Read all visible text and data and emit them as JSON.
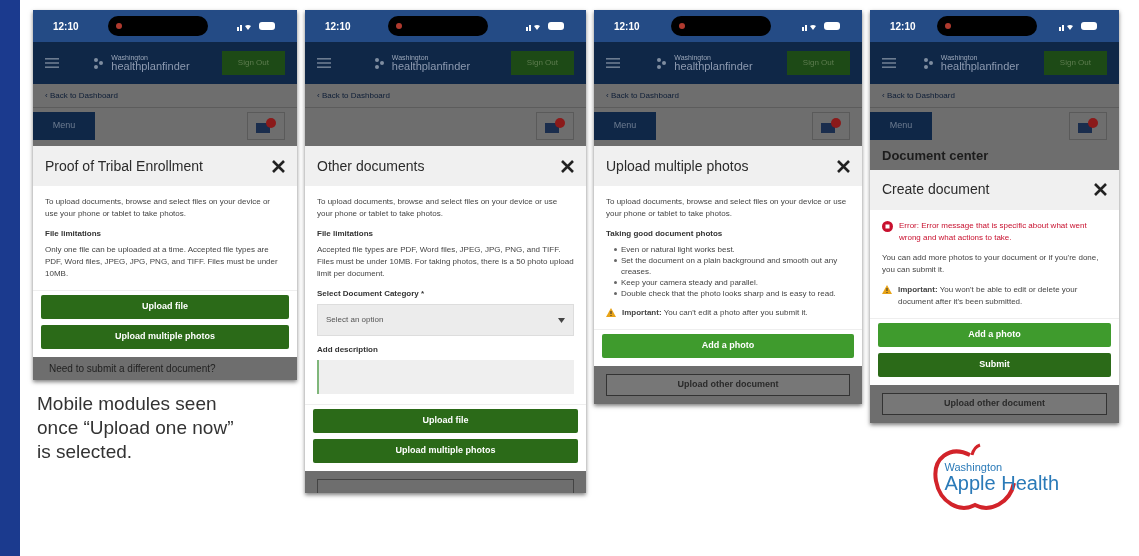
{
  "phones": [
    {
      "time": "12:10",
      "brand_top": "Washington",
      "brand": "healthplanfinder",
      "sign_out": "Sign Out",
      "back_link": "‹ Back to Dashboard",
      "menu": "Menu",
      "modal": {
        "title": "Proof of Tribal Enrollment",
        "blocks": [
          {
            "kind": "paragraph",
            "text": "To upload documents, browse and select files on your device or use your phone or tablet to take photos."
          },
          {
            "kind": "heading",
            "text": "File limitations"
          },
          {
            "kind": "paragraph",
            "text": "Only one file can be uploaded at a time. Accepted file types are PDF, Word files, JPEG, JPG, PNG, and TIFF. Files must be under 10MB."
          }
        ],
        "buttons": [
          {
            "label": "Upload file",
            "kind": "secondary"
          },
          {
            "label": "Upload multiple photos",
            "kind": "secondary"
          }
        ]
      },
      "below": {
        "kind": "text",
        "text": "Need to submit a different document?"
      }
    },
    {
      "time": "12:10",
      "brand_top": "Washington",
      "brand": "healthplanfinder",
      "sign_out": "Sign Out",
      "back_link": "‹ Back to Dashboard",
      "modal": {
        "title": "Other documents",
        "blocks": [
          {
            "kind": "paragraph",
            "text": "To upload documents, browse and select files on your device or use your phone or tablet to take photos."
          },
          {
            "kind": "heading",
            "text": "File limitations"
          },
          {
            "kind": "paragraph",
            "text": "Accepted file types are PDF, Word files, JPEG, JPG, PNG, and TIFF. Files must be under 10MB. For taking photos, there is a 50 photo upload limit per document."
          },
          {
            "kind": "select",
            "label": "Select Document Category *",
            "placeholder": "Select an option"
          },
          {
            "kind": "textarea",
            "label": "Add description"
          }
        ],
        "buttons": [
          {
            "label": "Upload file",
            "kind": "secondary"
          },
          {
            "label": "Upload multiple photos",
            "kind": "secondary"
          }
        ]
      },
      "below": {
        "kind": "blank"
      }
    },
    {
      "time": "12:10",
      "brand_top": "Washington",
      "brand": "healthplanfinder",
      "sign_out": "Sign Out",
      "back_link": "‹ Back to Dashboard",
      "menu": "Menu",
      "modal": {
        "title": "Upload multiple photos",
        "blocks": [
          {
            "kind": "paragraph",
            "text": "To upload documents, browse and select files on your device or use your phone or tablet to take photos."
          },
          {
            "kind": "heading",
            "text": "Taking good document photos"
          },
          {
            "kind": "list",
            "items": [
              "Even or natural light works best.",
              "Set the document on a plain background and smooth out any creases.",
              "Keep your camera steady and parallel.",
              "Double check that the photo looks sharp and is easy to read."
            ]
          },
          {
            "kind": "warning",
            "text": "**Important:** You can't edit a photo after you submit it."
          }
        ],
        "buttons": [
          {
            "label": "Add a photo",
            "kind": "primary"
          }
        ]
      },
      "below": {
        "kind": "button",
        "text": "Upload other document"
      }
    },
    {
      "time": "12:10",
      "brand_top": "Washington",
      "brand": "healthplanfinder",
      "sign_out": "Sign Out",
      "back_link": "‹ Back to Dashboard",
      "menu": "Menu",
      "page_heading": "Document center",
      "modal": {
        "title": "Create document",
        "blocks": [
          {
            "kind": "error",
            "text": "Error: Error message that is specific about what went wrong and what actions to take."
          },
          {
            "kind": "paragraph",
            "text": "You can add more photos to your document or if you're done, you can submit it."
          },
          {
            "kind": "warning",
            "text": "**Important:** You won't be able to edit or delete your document after it's been submitted."
          }
        ],
        "buttons": [
          {
            "label": "Add a photo",
            "kind": "primary"
          },
          {
            "label": "Submit",
            "kind": "secondary"
          }
        ]
      },
      "below": {
        "kind": "button",
        "text": "Upload other document"
      }
    }
  ],
  "caption": "Mobile modules seen once “Upload one now” is selected.",
  "logo": {
    "top": "Washington",
    "bottom": "Apple Health"
  }
}
